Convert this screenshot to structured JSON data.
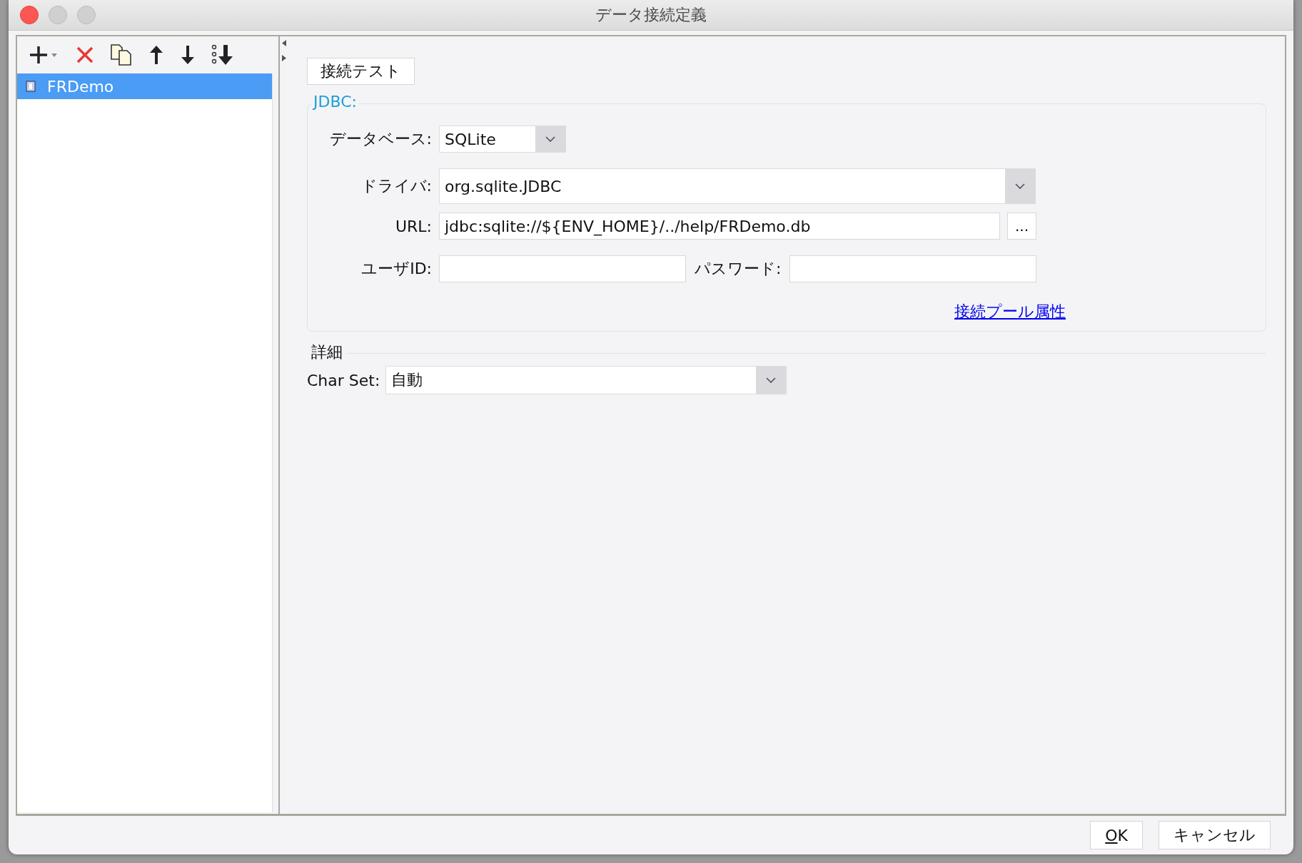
{
  "window": {
    "title": "データ接続定義"
  },
  "connections": [
    {
      "label": "FRDemo",
      "selected": true
    }
  ],
  "test_button": "接続テスト",
  "jdbc": {
    "legend": "JDBC:",
    "database": {
      "label": "データベース:",
      "value": "SQLite"
    },
    "driver": {
      "label": "ドライバ:",
      "value": "org.sqlite.JDBC"
    },
    "url": {
      "label": "URL:",
      "value": "jdbc:sqlite://${ENV_HOME}/../help/FRDemo.db",
      "browse": "..."
    },
    "user_id": {
      "label": "ユーザID:"
    },
    "password": {
      "label": "パスワード:"
    },
    "pool_link": "接続プール属性"
  },
  "details": {
    "heading": "詳細",
    "charset": {
      "label": "Char Set:",
      "value": "自動"
    }
  },
  "buttons": [
    {
      "label": "OK",
      "mnemonic_first": true
    },
    {
      "label": "キャンセル",
      "mnemonic_first": false
    }
  ]
}
